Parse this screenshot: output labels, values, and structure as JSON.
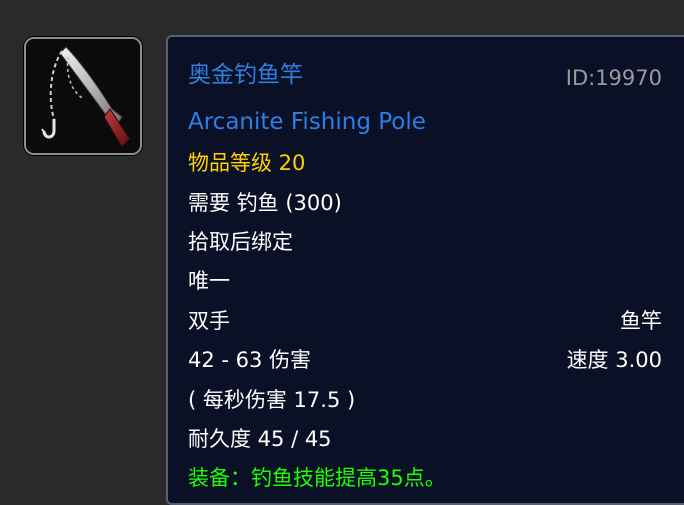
{
  "item": {
    "name_cn": "奥金钓鱼竿",
    "name_en": "Arcanite Fishing Pole",
    "id_label": "ID:19970",
    "item_level": "物品等级 20",
    "requirement": "需要 钓鱼 (300)",
    "bind": "拾取后绑定",
    "unique": "唯一",
    "slot": "双手",
    "type": "鱼竿",
    "damage": "42 - 63 伤害",
    "speed": "速度 3.00",
    "dps": "( 每秒伤害 17.5 )",
    "durability": "耐久度 45 / 45",
    "equip_effect": "装备：钓鱼技能提高35点。"
  },
  "colors": {
    "item_name": "#2f7fe3",
    "item_level": "#ffd100",
    "equip_effect": "#1eff00",
    "id_text": "#9a9a9a"
  },
  "icon": "fishing-pole-icon"
}
